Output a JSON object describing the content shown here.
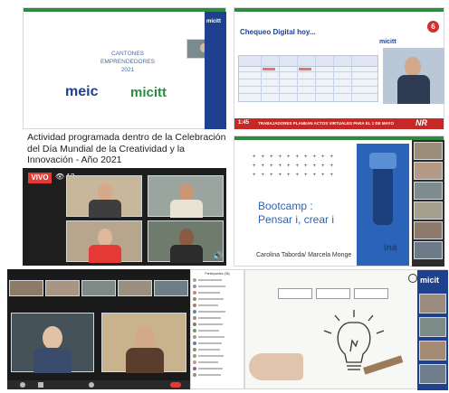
{
  "top_strip_text": "",
  "slide1": {
    "title_line1": "CANTONES",
    "title_line2": "EMPRENDEDORES",
    "year": "2021",
    "logo_meic": "meic",
    "logo_micitt": "micitt"
  },
  "slide2": {
    "title": "Chequeo Digital hoy...",
    "logo": "micitt",
    "channel_badge": "6",
    "ticker_time": "1:45",
    "ticker_text": "TRABAJADORES PLANEAN ACTOS VIRTUALES PARA EL 1 DE MAYO",
    "ticker_logo": "NR"
  },
  "caption": "Actividad programada dentro de la Celebración del Día Mundial de la Creatividad y la Innovación - Año 2021",
  "live": {
    "badge": "VIVO",
    "viewers": "12"
  },
  "bootcamp": {
    "title_line1": "Bootcamp :",
    "title_line2": "Pensar i, crear i",
    "presenters": "Carolina Taborda/ Marcela Monge",
    "logo": "ina",
    "logo_sub": "Instituto Nacional de Aprendizaje"
  },
  "participants_panel": {
    "header": "Participantes (38)"
  },
  "drawing": {
    "logo": "micit"
  },
  "colors": {
    "accent_green": "#2e8b3d",
    "ticker_red": "#c62828",
    "live_red": "#e53935",
    "micitt_blue": "#1f3f8f"
  }
}
